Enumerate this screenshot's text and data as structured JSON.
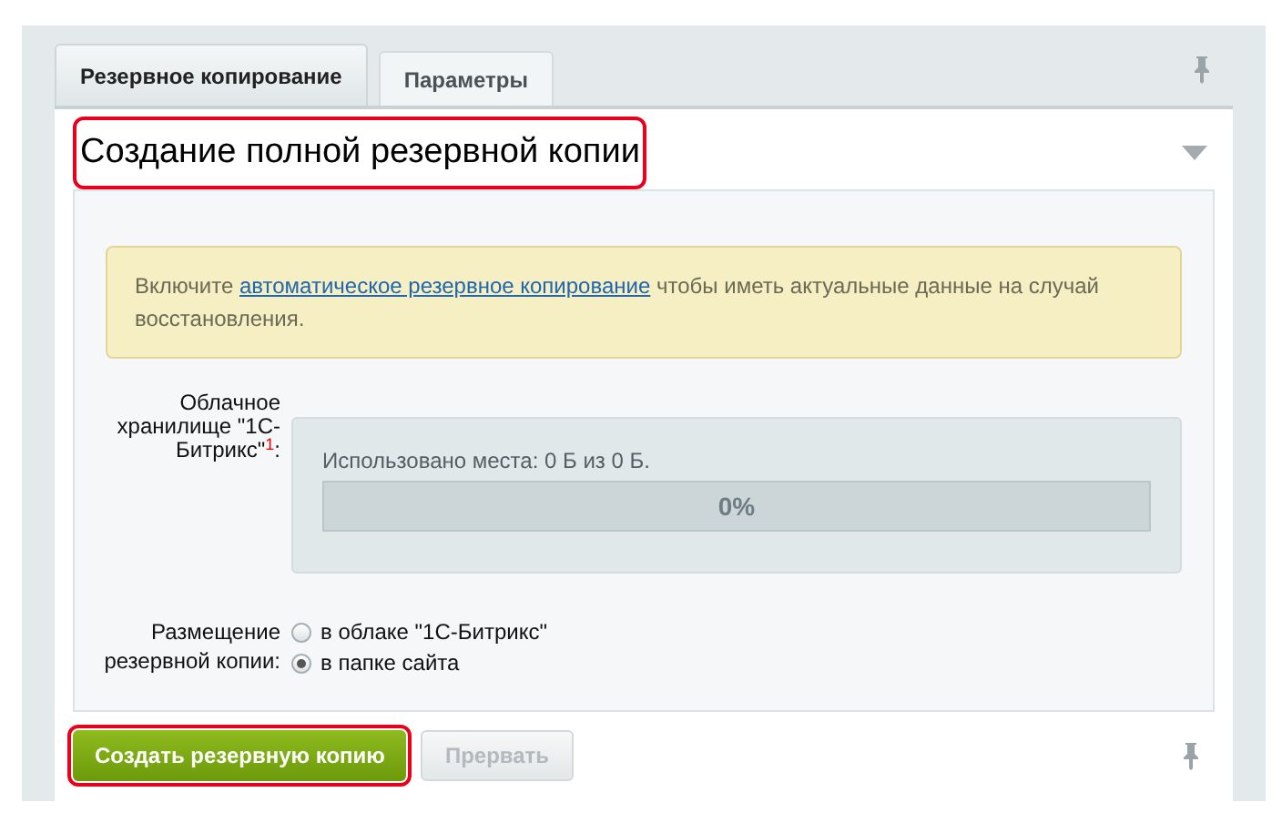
{
  "tabs": [
    {
      "label": "Резервное копирование",
      "selected": true
    },
    {
      "label": "Параметры",
      "selected": false
    }
  ],
  "section": {
    "title": "Создание полной резервной копии",
    "highlighted": true,
    "expanded": true
  },
  "notice": {
    "before": "Включите",
    "link": "автоматическое резервное копирование",
    "after": "чтобы иметь актуальные данные на случай восстановления."
  },
  "cloud_storage": {
    "label": "Облачное хранилище \"1С-Битрикс\"$^{1}$:",
    "usage": "Использовано места: 0 Б из 0 Б.",
    "level": 0,
    "reading": "0%"
  },
  "placement": {
    "label": "Размещение резервной копии:",
    "options": [
      {
        "label": "в облаке \"1С-Битрикс\"",
        "selected": false
      },
      {
        "label": "в папке сайта",
        "selected": true
      }
    ]
  },
  "buttons": [
    {
      "label": "Создать резервную копию",
      "kind": "primary",
      "disabled": false,
      "highlighted": true
    },
    {
      "label": "Прервать",
      "kind": "secondary",
      "disabled": true,
      "highlighted": false
    }
  ]
}
